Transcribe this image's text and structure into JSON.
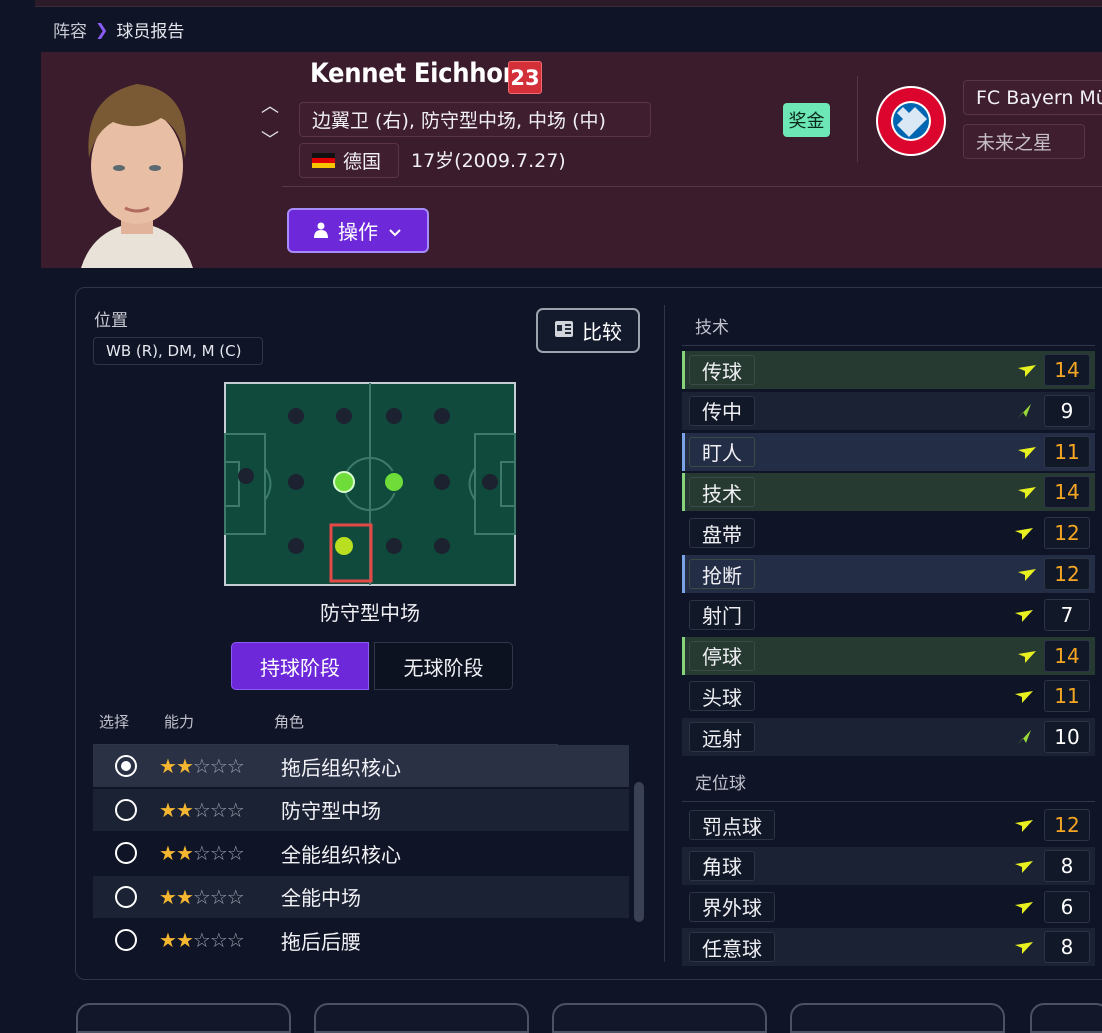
{
  "breadcrumb": {
    "parent": "阵容",
    "current": "球员报告"
  },
  "player": {
    "name": "Kennet Eichhorn",
    "number": "23",
    "positions": "边翼卫 (右), 防守型中场, 中场 (中)",
    "nationality": "德国",
    "age": "17岁(2009.7.27)",
    "action_label": "操作",
    "bonus_label": "奖金"
  },
  "club": {
    "name": "FC Bayern Mü",
    "tag": "未来之星"
  },
  "position_section": {
    "label": "位置",
    "tag": "WB (R), DM, M (C)",
    "compare_label": "比较",
    "pitch_caption": "防守型中场",
    "phase_on": "持球阶段",
    "phase_off": "无球阶段"
  },
  "roles": {
    "headers": {
      "select": "选择",
      "ability": "能力",
      "role": "角色"
    },
    "items": [
      {
        "name": "拖后组织核心",
        "stars": 2,
        "max_stars": 5,
        "selected": true
      },
      {
        "name": "防守型中场",
        "stars": 2,
        "max_stars": 5,
        "selected": false
      },
      {
        "name": "全能组织核心",
        "stars": 2,
        "max_stars": 5,
        "selected": false
      },
      {
        "name": "全能中场",
        "stars": 2,
        "max_stars": 5,
        "selected": false
      },
      {
        "name": "拖后后腰",
        "stars": 2,
        "max_stars": 5,
        "selected": false
      }
    ]
  },
  "attributes": {
    "technical_title": "技术",
    "technical": [
      {
        "name": "传球",
        "value": "14",
        "highlight": "green",
        "trend": "flat"
      },
      {
        "name": "传中",
        "value": "9",
        "highlight": "",
        "trend": "up"
      },
      {
        "name": "盯人",
        "value": "11",
        "highlight": "blue",
        "trend": "flat"
      },
      {
        "name": "技术",
        "value": "14",
        "highlight": "green",
        "trend": "flat"
      },
      {
        "name": "盘带",
        "value": "12",
        "highlight": "",
        "trend": "flat"
      },
      {
        "name": "抢断",
        "value": "12",
        "highlight": "blue",
        "trend": "flat"
      },
      {
        "name": "射门",
        "value": "7",
        "highlight": "",
        "trend": "flat"
      },
      {
        "name": "停球",
        "value": "14",
        "highlight": "green",
        "trend": "flat"
      },
      {
        "name": "头球",
        "value": "11",
        "highlight": "",
        "trend": "flat"
      },
      {
        "name": "远射",
        "value": "10",
        "highlight": "",
        "trend": "up"
      }
    ],
    "set_pieces_title": "定位球",
    "set_pieces": [
      {
        "name": "罚点球",
        "value": "12",
        "highlight": "",
        "trend": "flat"
      },
      {
        "name": "角球",
        "value": "8",
        "highlight": "",
        "trend": "flat"
      },
      {
        "name": "界外球",
        "value": "6",
        "highlight": "",
        "trend": "flat"
      },
      {
        "name": "任意球",
        "value": "8",
        "highlight": "",
        "trend": "flat"
      }
    ]
  },
  "colors": {
    "accent": "#6d28d9",
    "value_high": "#f5a623",
    "value_normal": "#ffffff",
    "trend_flat": "#e8f020",
    "trend_up": "#9ad83a",
    "header_bg": "#3b1c2c"
  }
}
